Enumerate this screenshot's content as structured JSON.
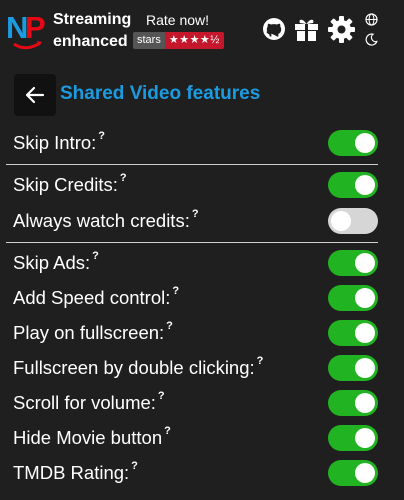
{
  "header": {
    "logo_text": "NP",
    "brand_line1": "Streaming",
    "brand_line2": "enhanced",
    "rate_label": "Rate now!",
    "stars_label": "stars",
    "stars_value": "★★★★½",
    "icons": [
      "github-icon",
      "gift-icon",
      "gear-icon",
      "globe-icon",
      "moon-icon"
    ],
    "colors": {
      "logo_red": "#e50914",
      "logo_blue": "#1b9be0",
      "badge_red": "#c4172b"
    }
  },
  "page": {
    "title": "Shared Video features",
    "title_color": "#1b9be0"
  },
  "settings": [
    {
      "label": "Skip Intro:",
      "on": true
    },
    {
      "label": "Skip Credits:",
      "on": true
    },
    {
      "label": "Always watch credits:",
      "on": false
    },
    {
      "label": "Skip Ads:",
      "on": true
    },
    {
      "label": "Add Speed control:",
      "on": true
    },
    {
      "label": "Play on fullscreen:",
      "on": true
    },
    {
      "label": "Fullscreen by double clicking:",
      "on": true
    },
    {
      "label": "Scroll for volume:",
      "on": true
    },
    {
      "label": "Hide Movie button",
      "on": true
    },
    {
      "label": "TMDB Rating:",
      "on": true
    }
  ],
  "help_mark": "?",
  "colors": {
    "toggle_on": "#21b321",
    "toggle_off": "#d6d6d6"
  }
}
